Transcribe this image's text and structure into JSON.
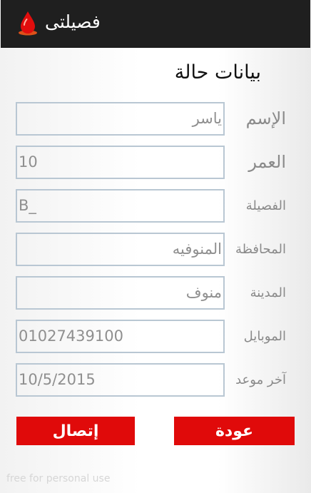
{
  "app_bar": {
    "title": "فصيلتى",
    "icon": "blood-drop-icon"
  },
  "heading": "بيانات حالة",
  "fields": [
    {
      "label": "الإسم",
      "value": "ياسر"
    },
    {
      "label": "العمر",
      "value": "10"
    },
    {
      "label": "الفصيلة",
      "value": "B_"
    },
    {
      "label": "المحافظة",
      "value": "المنوفيه"
    },
    {
      "label": "المدينة",
      "value": "منوف"
    },
    {
      "label": "الموبايل",
      "value": "01027439100"
    },
    {
      "label": "آخر موعد",
      "value": "10/5/2015"
    }
  ],
  "buttons": {
    "back": "عودة",
    "contact": "إتصال"
  },
  "watermark": "free for personal use",
  "colors": {
    "accent_red": "#e00a0a",
    "app_bar": "#1f1f1f",
    "field_border": "#b9c7d3"
  }
}
